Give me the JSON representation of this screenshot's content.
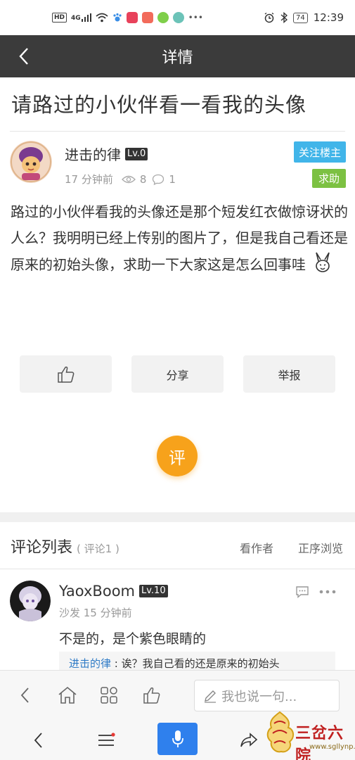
{
  "status_bar": {
    "signal_badges": [
      "HD",
      "4G"
    ],
    "battery": "74",
    "time": "12:39",
    "app_icon_colors": [
      "#e8425b",
      "#f26b5b",
      "#7fcf4a",
      "#6cc3b8"
    ]
  },
  "nav": {
    "title": "详情"
  },
  "post": {
    "title": "请路过的小伙伴看一看我的头像",
    "author": "进击的律",
    "author_level": "Lv.0",
    "time": "17 分钟前",
    "views": "8",
    "comments": "1",
    "follow_label": "关注楼主",
    "tag": "求助",
    "body": "路过的小伙伴看我的头像还是那个短发红衣做惊讶状的人么？我明明已经上传别的图片了，但是我自己看还是原来的初始头像，求助一下大家这是怎么回事哇"
  },
  "actions": {
    "share_label": "分享",
    "report_label": "举报",
    "comment_fab_label": "评"
  },
  "comments_section": {
    "title": "评论列表",
    "count_label": "( 评论1 )",
    "author_only_label": "看作者",
    "order_label": "正序浏览"
  },
  "comments": [
    {
      "name": "YaoxBoom",
      "level": "Lv.10",
      "meta": "沙发 15 分钟前",
      "text": "不是的，是个紫色眼睛的",
      "quote_name": "进击的律",
      "quote_text": "诶？我自己看的还是原来的初始头"
    }
  ],
  "toolbar": {
    "say_placeholder": "我也说一句..."
  },
  "watermark": {
    "text": "三岔六院",
    "url": "www.sgllynp.com"
  },
  "colors": {
    "nav_bg": "#3b3b3b",
    "follow_blue": "#41b5e9",
    "help_green": "#7cc142",
    "fab_orange": "#f7a21b",
    "mic_blue": "#2f80ed",
    "quote_link": "#2f7bc6"
  }
}
